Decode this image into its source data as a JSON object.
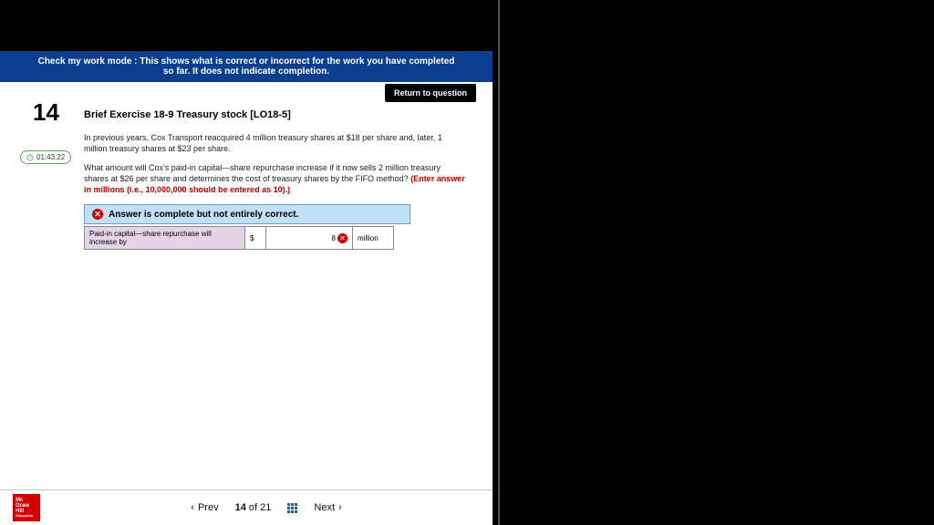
{
  "banner": "Check my work mode : This shows what is correct or incorrect for the work you have completed so far. It does not indicate completion.",
  "return_btn": "Return to question",
  "question_number": "14",
  "timer": "01:43:22",
  "q": {
    "title": "Brief Exercise 18-9 Treasury stock [LO18-5]",
    "p1": "In previous years, Cox Transport reacquired 4 million treasury shares at $18 per share and, later, 1 million treasury shares at $23 per share.",
    "p2a": "What amount will Cox's paid-in capital—share repurchase increase if it now sells 2 million treasury shares at $26 per share and determines the cost of treasury shares by the FIFO method? ",
    "p2b": "(Enter answer in millions (i.e., 10,000,000 should be entered as 10).)"
  },
  "answer_bar": "Answer is complete but not entirely correct.",
  "row": {
    "label": "Paid-in capital—share repurchase will increase by",
    "currency": "$",
    "value": "8",
    "unit": "million"
  },
  "nav": {
    "prev": "Prev",
    "next": "Next",
    "current": "14",
    "of": "of",
    "total": "21"
  },
  "logo": {
    "l1": "Mc",
    "l2": "Graw",
    "l3": "Hill",
    "l4": "Education"
  }
}
